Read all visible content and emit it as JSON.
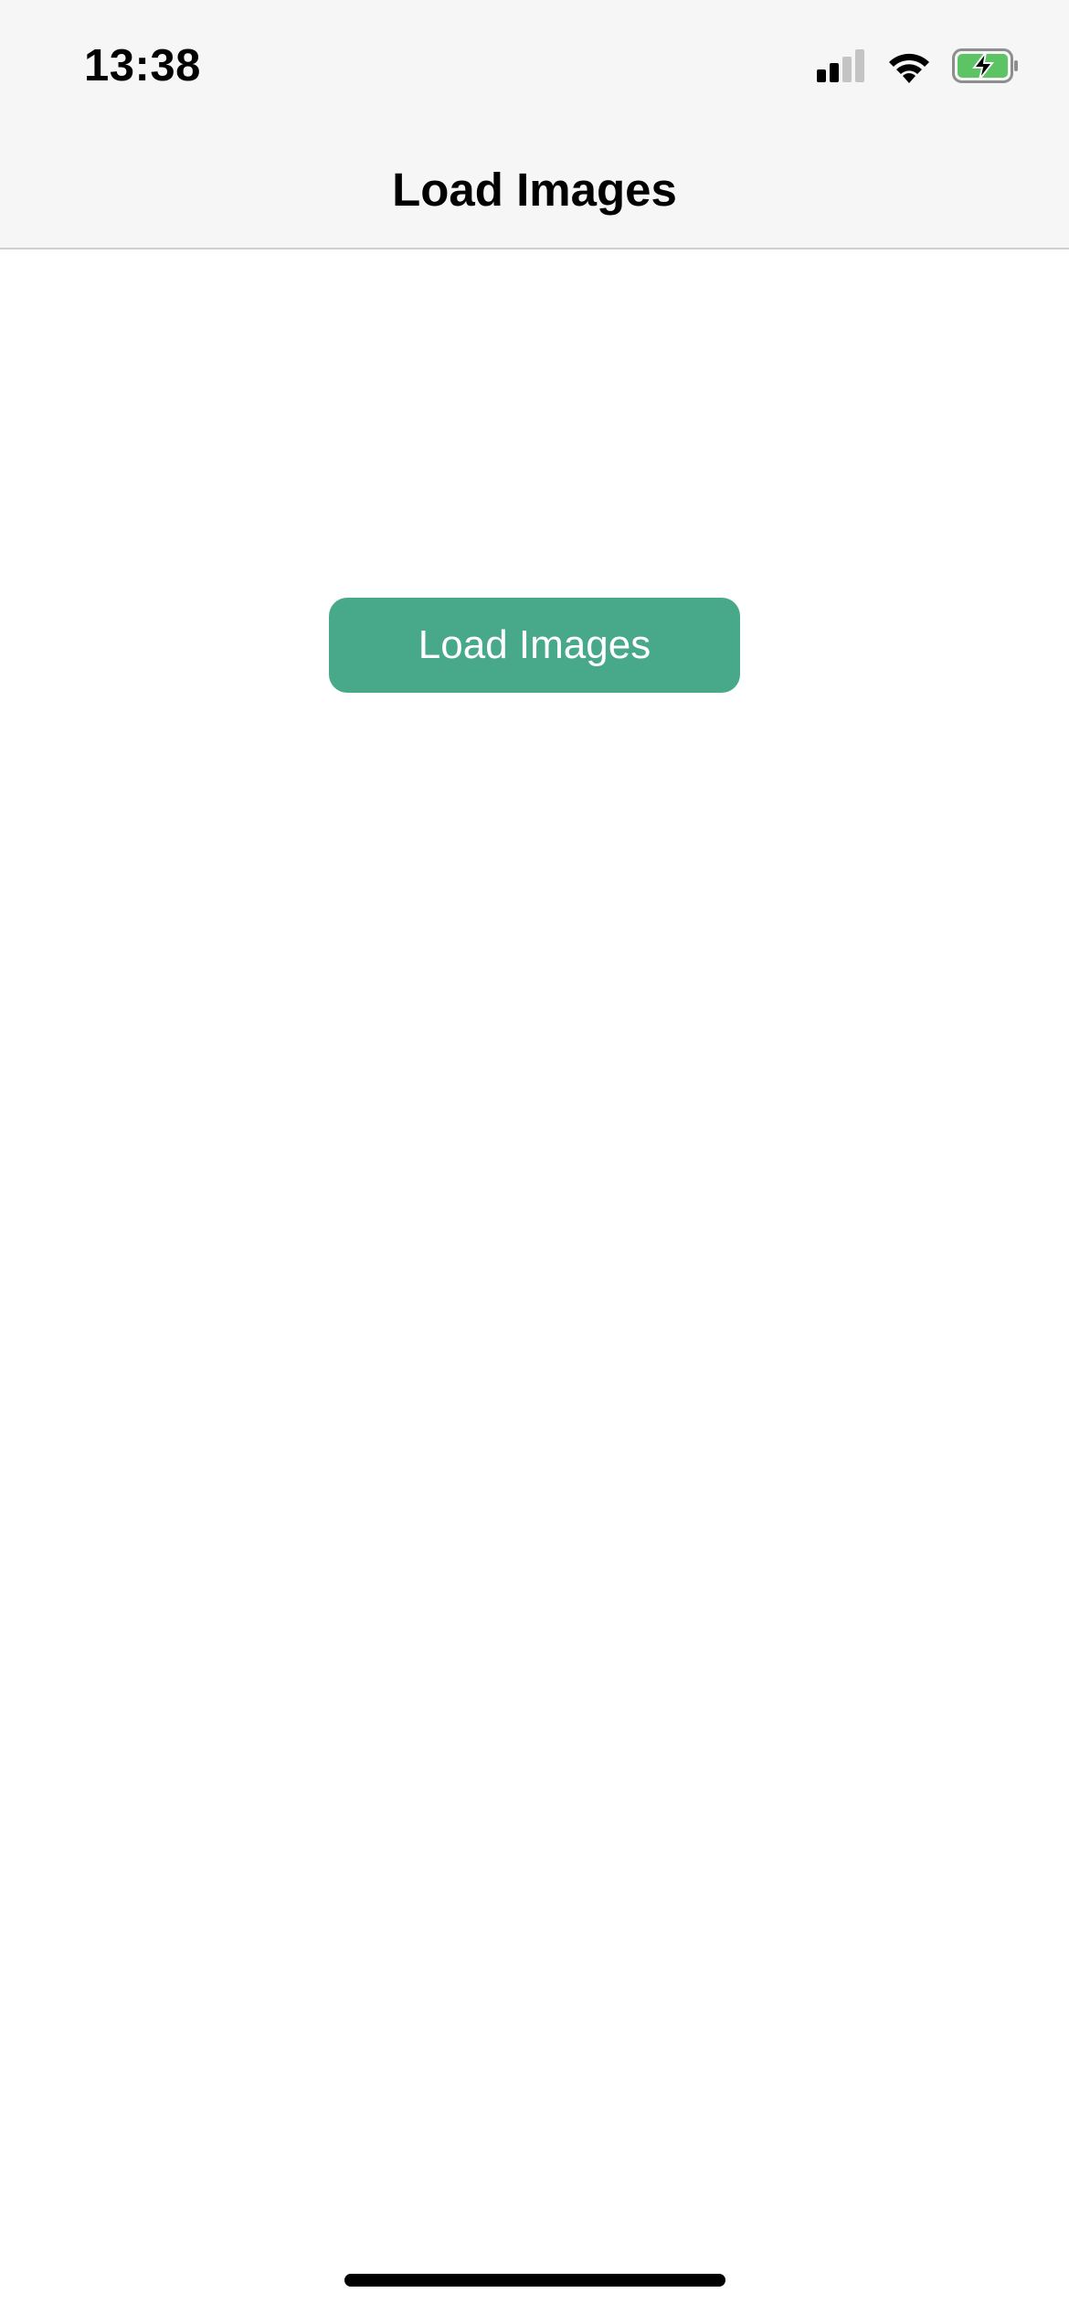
{
  "status_bar": {
    "time": "13:38",
    "icons": [
      "cellular-signal-icon",
      "wifi-icon",
      "battery-charging-icon"
    ],
    "battery_color": "#5dc466"
  },
  "nav_bar": {
    "title": "Load Images"
  },
  "main": {
    "load_button_label": "Load Images",
    "accent_color": "#48a88a"
  }
}
